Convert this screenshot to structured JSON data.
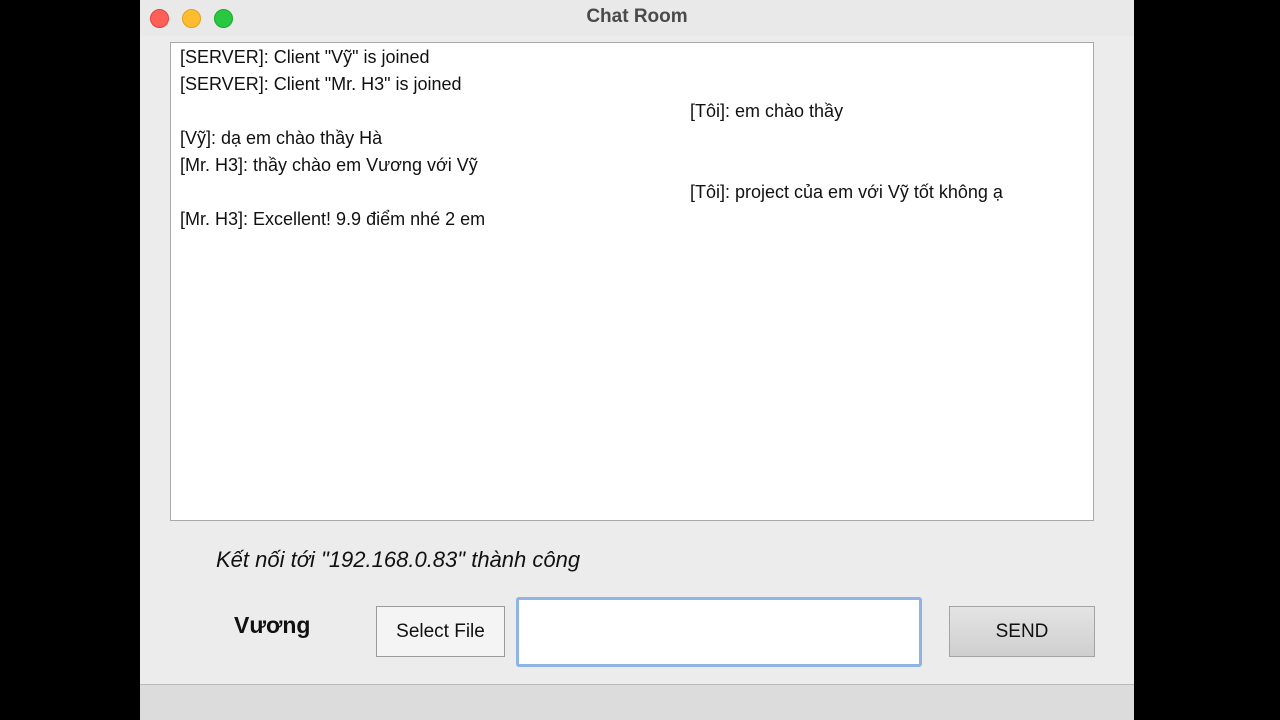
{
  "window": {
    "title": "Chat Room"
  },
  "messages": [
    {
      "text": "[SERVER]: Client \"Vỹ\" is joined",
      "align": "left"
    },
    {
      "text": "[SERVER]: Client \"Mr. H3\" is joined",
      "align": "left"
    },
    {
      "text": "[Tôi]: em chào thầy",
      "align": "right"
    },
    {
      "text": "[Vỹ]: dạ em chào thầy Hà",
      "align": "left"
    },
    {
      "text": "[Mr. H3]: thầy chào em Vương với Vỹ",
      "align": "left"
    },
    {
      "text": "[Tôi]: project của em với Vỹ tốt không ạ",
      "align": "right"
    },
    {
      "text": "[Mr. H3]: Excellent! 9.9 điểm nhé 2 em",
      "align": "left"
    }
  ],
  "status": "Kết nối tới \"192.168.0.83\" thành công",
  "username": "Vương",
  "buttons": {
    "select_file": "Select File",
    "send": "SEND"
  },
  "input": {
    "value": ""
  },
  "colors": {
    "close": "#fe5f57",
    "minimize": "#febc2e",
    "zoom": "#28c840",
    "input_focus": "#8fb3e3"
  }
}
